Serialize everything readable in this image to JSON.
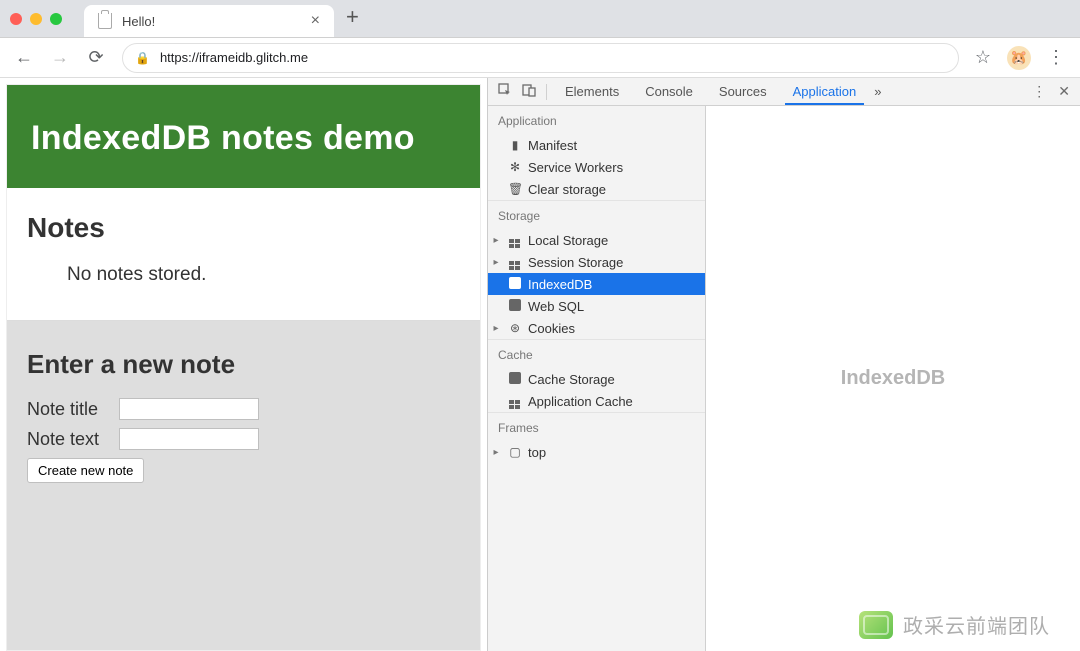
{
  "browser": {
    "tab_title": "Hello!",
    "url_host": "https://iframeidb.glitch.me",
    "avatar_emoji": "🐹"
  },
  "page": {
    "hero_title": "IndexedDB notes demo",
    "notes_heading": "Notes",
    "notes_empty": "No notes stored.",
    "form_heading": "Enter a new note",
    "title_label": "Note title",
    "text_label": "Note text",
    "create_label": "Create new note"
  },
  "devtools": {
    "tabs": {
      "elements": "Elements",
      "console": "Console",
      "sources": "Sources",
      "application": "Application"
    },
    "sections": {
      "application": "Application",
      "storage": "Storage",
      "cache": "Cache",
      "frames": "Frames"
    },
    "items": {
      "manifest": "Manifest",
      "service_workers": "Service Workers",
      "clear_storage": "Clear storage",
      "local_storage": "Local Storage",
      "session_storage": "Session Storage",
      "indexeddb": "IndexedDB",
      "web_sql": "Web SQL",
      "cookies": "Cookies",
      "cache_storage": "Cache Storage",
      "app_cache": "Application Cache",
      "top": "top"
    },
    "main_placeholder": "IndexedDB"
  },
  "watermark": "政采云前端团队"
}
